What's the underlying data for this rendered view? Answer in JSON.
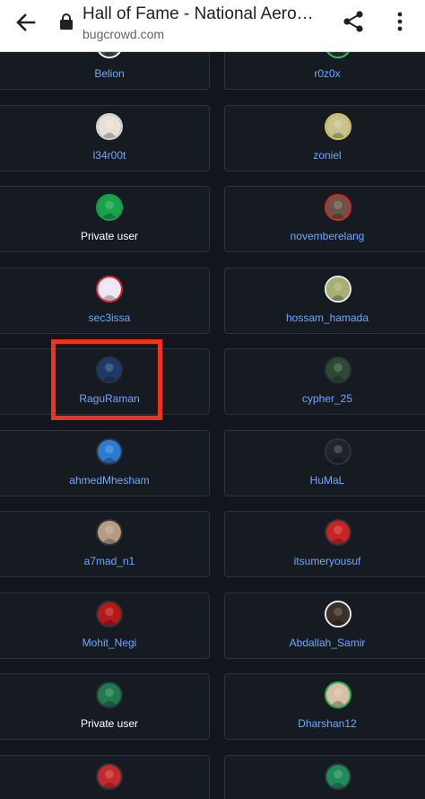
{
  "browser": {
    "title": "Hall of Fame - National Aero…",
    "url": "bugcrowd.com"
  },
  "colors": {
    "background": "#12161c",
    "card": "#161b22",
    "card_border": "#2c333d",
    "username": "#6fa8ff",
    "highlight": "#f0331c"
  },
  "rows": [
    {
      "left": {
        "name": "Belion",
        "ring": "#ffffff",
        "fill": "#444b55"
      },
      "right": {
        "name": "r0z0x",
        "ring": "#30c060",
        "fill": "#2c3a30"
      }
    },
    {
      "left": {
        "name": "l34r00t",
        "ring": "#cfd6de",
        "fill": "#e8e0d4"
      },
      "right": {
        "name": "zoniel",
        "ring": "#d6c35a",
        "fill": "#c8c38a"
      }
    },
    {
      "left": {
        "name": "Private user",
        "ring": "#14a14a",
        "fill": "#19a34a",
        "private": true
      },
      "right": {
        "name": "novemberelang",
        "ring": "#e0242b",
        "fill": "#6d5446"
      }
    },
    {
      "left": {
        "name": "sec3issa",
        "ring": "#e0242b",
        "fill": "#ece6f5"
      },
      "right": {
        "name": "hossam_hamada",
        "ring": "#e9ecef",
        "fill": "#a7b070"
      }
    },
    {
      "left": {
        "name": "RaguRaman",
        "ring": "#2c333d",
        "fill": "#1d3a6a"
      },
      "right": {
        "name": "cypher_25",
        "ring": "#2c333d",
        "fill": "#2f4a34"
      }
    },
    {
      "left": {
        "name": "ahmedMhesham",
        "ring": "#2c333d",
        "fill": "#2a7bd1"
      },
      "right": {
        "name": "HuMaL",
        "ring": "#2c333d",
        "fill": "#1f242a"
      }
    },
    {
      "left": {
        "name": "a7mad_n1",
        "ring": "#2c333d",
        "fill": "#b79c82"
      },
      "right": {
        "name": "itsumeryousuf",
        "ring": "#2c333d",
        "fill": "#c72424"
      }
    },
    {
      "left": {
        "name": "Mohit_Negi",
        "ring": "#2c333d",
        "fill": "#b51919"
      },
      "right": {
        "name": "Abdallah_Samir",
        "ring": "#e9ecef",
        "fill": "#3a3128"
      }
    },
    {
      "left": {
        "name": "Private user",
        "ring": "#2c333d",
        "fill": "#1f7a4c",
        "private": true
      },
      "right": {
        "name": "Dharshan12",
        "ring": "#27b04f",
        "fill": "#d8c0a8"
      }
    },
    {
      "left": {
        "name": "",
        "ring": "#2c333d",
        "fill": "#c42a2a"
      },
      "right": {
        "name": "",
        "ring": "#2c333d",
        "fill": "#1f8a5a"
      }
    }
  ]
}
